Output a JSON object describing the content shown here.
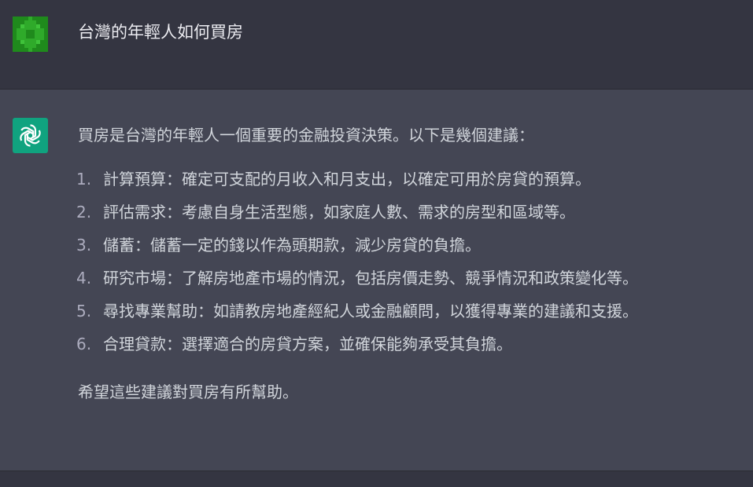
{
  "user_message": {
    "avatar_icon": "green-pixel-avatar-icon",
    "text": "台灣的年輕人如何買房"
  },
  "assistant_message": {
    "avatar_icon": "openai-logo-icon",
    "intro": "買房是台灣的年輕人一個重要的金融投資決策。以下是幾個建議：",
    "items": [
      {
        "num": "1.",
        "text": "計算預算：確定可支配的月收入和月支出，以確定可用於房貸的預算。"
      },
      {
        "num": "2.",
        "text": "評估需求：考慮自身生活型態，如家庭人數、需求的房型和區域等。"
      },
      {
        "num": "3.",
        "text": "儲蓄：儲蓄一定的錢以作為頭期款，減少房貸的負擔。"
      },
      {
        "num": "4.",
        "text": "研究市場：了解房地產市場的情況，包括房價走勢、競爭情況和政策變化等。"
      },
      {
        "num": "5.",
        "text": "尋找專業幫助：如請教房地產經紀人或金融顧問，以獲得專業的建議和支援。"
      },
      {
        "num": "6.",
        "text": "合理貸款：選擇適合的房貸方案，並確保能夠承受其負擔。"
      }
    ],
    "outro": "希望這些建議對買房有所幫助。"
  },
  "colors": {
    "user_bg": "#343541",
    "assistant_bg": "#444654",
    "assistant_avatar": "#10a37f",
    "user_avatar": "#1f8a1c"
  }
}
